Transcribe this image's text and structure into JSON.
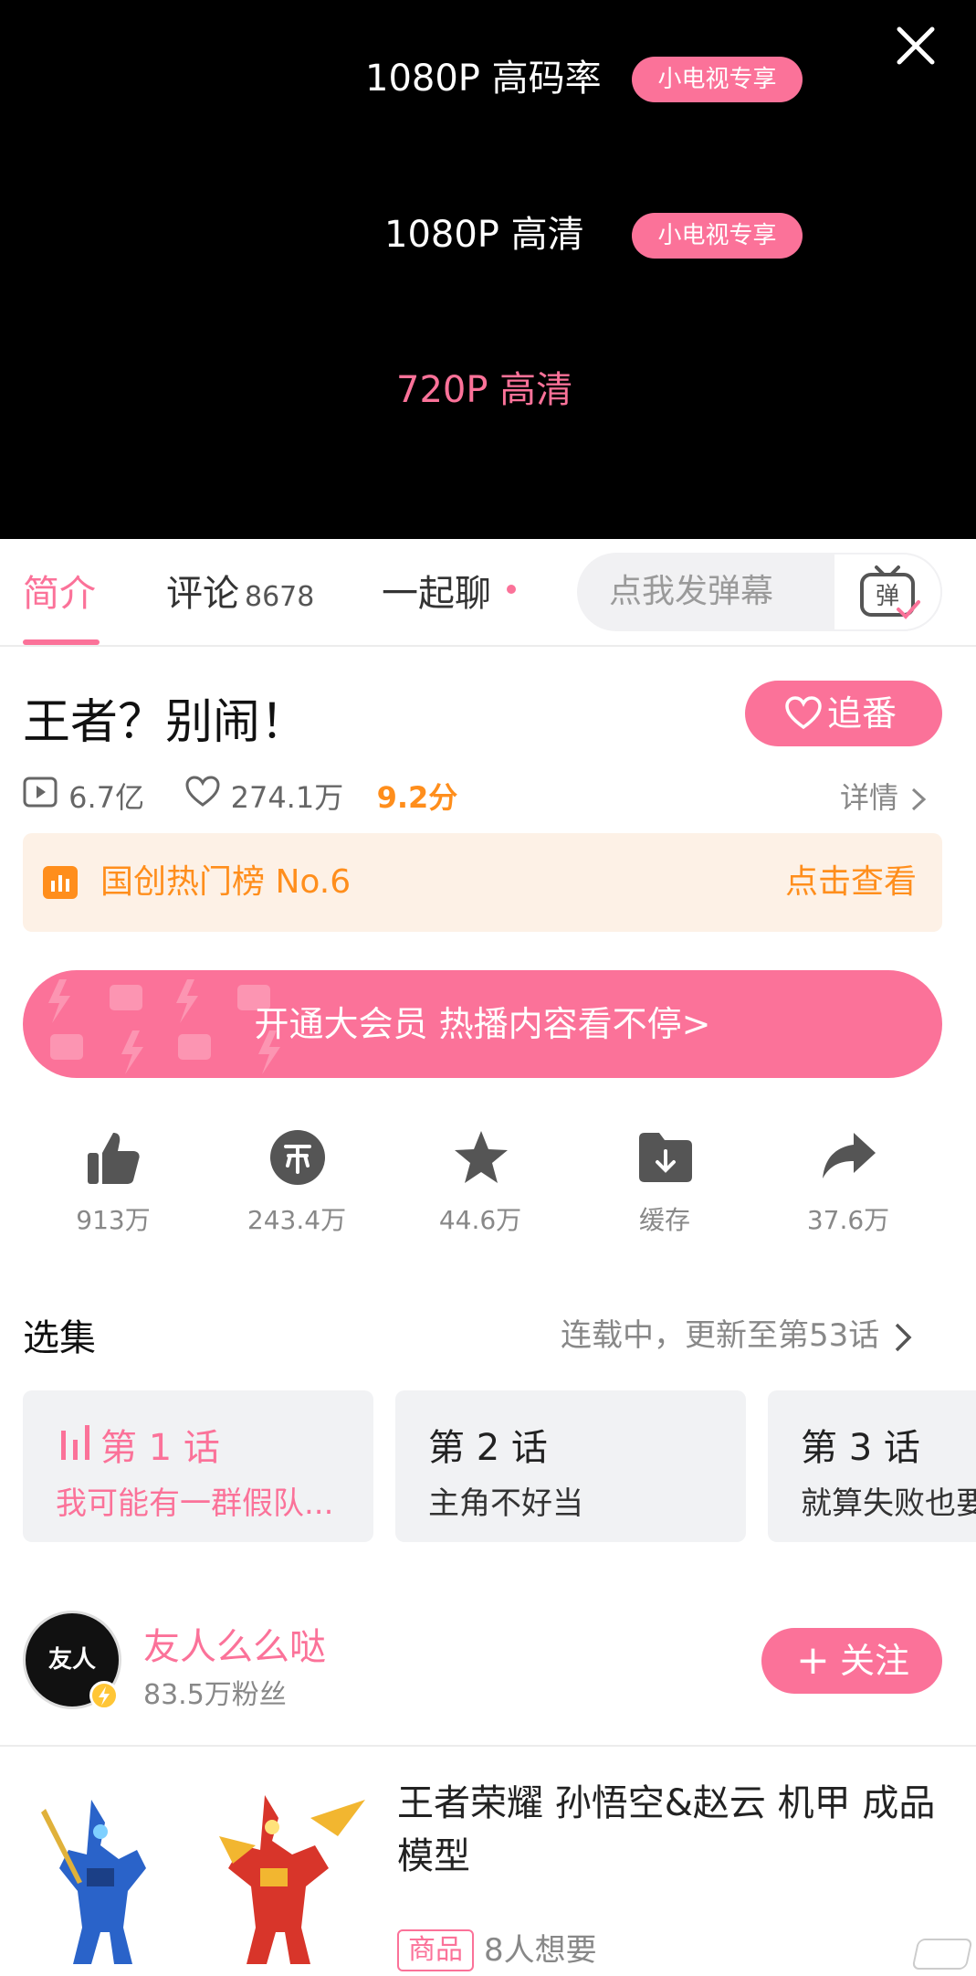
{
  "quality": {
    "options": [
      {
        "label": "1080P 高码率",
        "badge": "小电视专享"
      },
      {
        "label": "1080P 高清",
        "badge": "小电视专享"
      },
      {
        "label": "720P 高清",
        "badge": ""
      }
    ]
  },
  "tabs": {
    "intro": "简介",
    "comments": "评论",
    "comments_count": "8678",
    "chat": "一起聊"
  },
  "danmaku": {
    "placeholder": "点我发弹幕",
    "button": "弹"
  },
  "show": {
    "title": "王者？别闹！",
    "follow_label": "追番",
    "plays": "6.7亿",
    "likes": "274.1万",
    "score": "9.2分",
    "details": "详情"
  },
  "ranking": {
    "text": "国创热门榜 No.6",
    "link": "点击查看"
  },
  "vip_banner": "开通大会员 热播内容看不停>",
  "actions": [
    {
      "icon": "thumbs-up-icon",
      "label": "913万"
    },
    {
      "icon": "coin-icon",
      "label": "243.4万"
    },
    {
      "icon": "star-icon",
      "label": "44.6万"
    },
    {
      "icon": "download-folder-icon",
      "label": "缓存"
    },
    {
      "icon": "share-icon",
      "label": "37.6万"
    }
  ],
  "episodes": {
    "title": "选集",
    "meta": "连载中，更新至第53话",
    "items": [
      {
        "title": "第 1 话",
        "subtitle": "我可能有一群假队..."
      },
      {
        "title": "第 2 话",
        "subtitle": "主角不好当"
      },
      {
        "title": "第 3 话",
        "subtitle": "就算失败也要"
      }
    ]
  },
  "uploader": {
    "avatar_text": "友人",
    "name": "友人么么哒",
    "fans": "83.5万粉丝",
    "follow_label": "关注"
  },
  "product": {
    "title": "王者荣耀  孙悟空&赵云 机甲 成品模型",
    "tag": "商品",
    "want": "8人想要"
  },
  "colors": {
    "accent": "#fb7299",
    "orange": "#ff8e1c",
    "black": "#000000"
  }
}
